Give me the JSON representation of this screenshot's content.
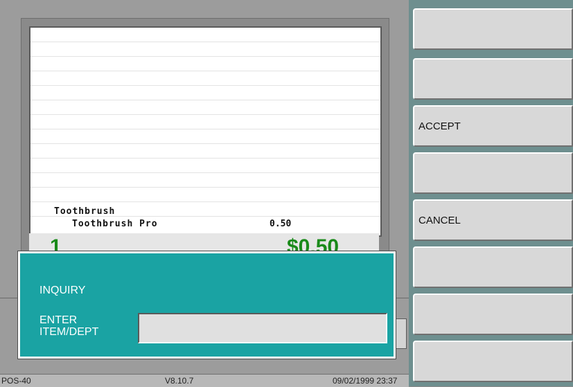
{
  "receipt": {
    "department": "Toothbrush",
    "item_name": "Toothbrush Pro",
    "item_price": "0.50",
    "quantity": "1",
    "total": "$0.50"
  },
  "dialog": {
    "title": "INQUIRY",
    "label_line1": "ENTER",
    "label_line2": "ITEM/DEPT",
    "input_value": ""
  },
  "status": {
    "terminal": "POS-40",
    "version": "V8.10.7",
    "datetime": "09/02/1999 23:37"
  },
  "keys": [
    "",
    "",
    "ACCEPT",
    "",
    "CANCEL",
    "",
    "",
    ""
  ]
}
